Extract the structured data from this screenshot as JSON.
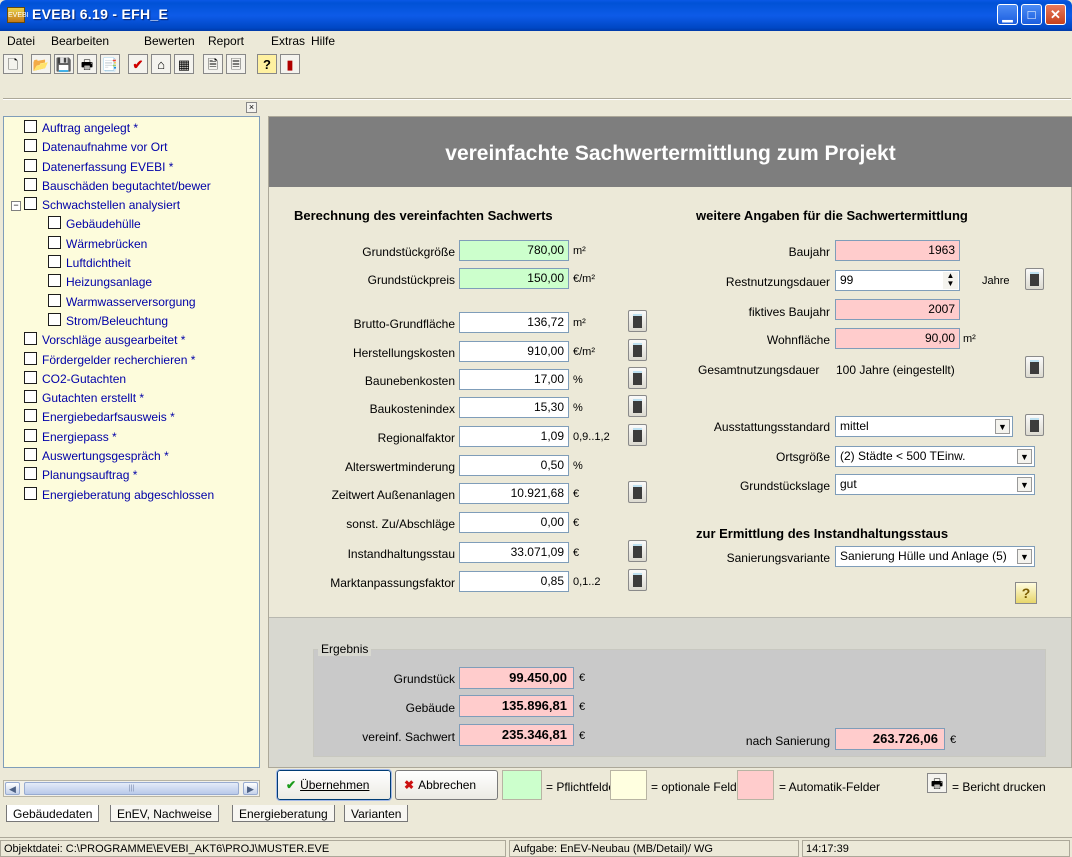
{
  "window": {
    "title": "EVEBI 6.19 - EFH_E",
    "icon_text": "EVEBI"
  },
  "menu": [
    "Datei",
    "Bearbeiten",
    "Bewerten",
    "Report",
    "Extras",
    "Hilfe"
  ],
  "tree": [
    {
      "label": "Auftrag angelegt *",
      "level": 0
    },
    {
      "label": "Datenaufnahme vor Ort",
      "level": 0
    },
    {
      "label": "Datenerfassung EVEBI *",
      "level": 0
    },
    {
      "label": "Bauschäden begutachtet/bewer",
      "level": 0
    },
    {
      "label": "Schwachstellen analysiert",
      "level": 0,
      "expander": "−"
    },
    {
      "label": "Gebäudehülle",
      "level": 1
    },
    {
      "label": "Wärmebrücken",
      "level": 1
    },
    {
      "label": "Luftdichtheit",
      "level": 1
    },
    {
      "label": "Heizungsanlage",
      "level": 1
    },
    {
      "label": "Warmwasserversorgung",
      "level": 1
    },
    {
      "label": "Strom/Beleuchtung",
      "level": 1
    },
    {
      "label": "Vorschläge ausgearbeitet *",
      "level": 0
    },
    {
      "label": "Fördergelder recherchieren *",
      "level": 0
    },
    {
      "label": "CO2-Gutachten",
      "level": 0
    },
    {
      "label": "Gutachten erstellt *",
      "level": 0
    },
    {
      "label": "Energiebedarfsausweis *",
      "level": 0
    },
    {
      "label": "Energiepass *",
      "level": 0
    },
    {
      "label": "Auswertungsgespräch *",
      "level": 0
    },
    {
      "label": "Planungsauftrag *",
      "level": 0
    },
    {
      "label": "Energieberatung abgeschlossen",
      "level": 0
    }
  ],
  "main": {
    "title": "vereinfachte Sachwertermittlung zum Projekt",
    "left_section": "Berechnung des vereinfachten Sachwerts",
    "right_section": "weitere Angaben für die Sachwertermittlung",
    "instand_section": "zur Ermittlung des Instandhaltungsstaus"
  },
  "left_rows": [
    {
      "label": "Grundstückgröße",
      "value": "780,00",
      "unit": "m²",
      "color": "green",
      "calc": false
    },
    {
      "label": "Grundstückpreis",
      "value": "150,00",
      "unit": "€/m²",
      "color": "green",
      "calc": false
    },
    {
      "label": "Brutto-Grundfläche",
      "value": "136,72",
      "unit": "m²",
      "color": "white",
      "calc": true
    },
    {
      "label": "Herstellungskosten",
      "value": "910,00",
      "unit": "€/m²",
      "color": "white",
      "calc": true
    },
    {
      "label": "Baunebenkosten",
      "value": "17,00",
      "unit": "%",
      "color": "white",
      "calc": true
    },
    {
      "label": "Baukostenindex",
      "value": "15,30",
      "unit": "%",
      "color": "white",
      "calc": true
    },
    {
      "label": "Regionalfaktor",
      "value": "1,09",
      "unit": "0,9..1,2",
      "color": "white",
      "calc": true
    },
    {
      "label": "Alterswertminderung",
      "value": "0,50",
      "unit": "%",
      "color": "white",
      "calc": false
    },
    {
      "label": "Zeitwert Außenanlagen",
      "value": "10.921,68",
      "unit": "€",
      "color": "white",
      "calc": true
    },
    {
      "label": "sonst. Zu/Abschläge",
      "value": "0,00",
      "unit": "€",
      "color": "white",
      "calc": false
    },
    {
      "label": "Instandhaltungsstau",
      "value": "33.071,09",
      "unit": "€",
      "color": "white",
      "calc": true
    },
    {
      "label": "Marktanpassungsfaktor",
      "value": "0,85",
      "unit": "0,1..2",
      "color": "white",
      "calc": true
    }
  ],
  "right": {
    "baujahr_label": "Baujahr",
    "baujahr": "1963",
    "restnutzung_label": "Restnutzungsdauer",
    "restnutzung": "99",
    "restnutzung_unit": "Jahre",
    "fiktiv_label": "fiktives Baujahr",
    "fiktiv": "2007",
    "wohnflaeche_label": "Wohnfläche",
    "wohnflaeche": "90,00",
    "wohnflaeche_unit": "m²",
    "gesamt_label": "Gesamtnutzungsdauer",
    "gesamt_value": "100 Jahre (eingestellt)",
    "ausstattung_label": "Ausstattungsstandard",
    "ausstattung": "mittel",
    "ortsgroesse_label": "Ortsgröße",
    "ortsgroesse": "(2) Städte < 500 TEinw.",
    "lage_label": "Grundstückslage",
    "lage": "gut",
    "sanierung_label": "Sanierungsvariante",
    "sanierung": "Sanierung Hülle und Anlage (5)"
  },
  "result": {
    "legend": "Ergebnis",
    "grundstueck_label": "Grundstück",
    "grundstueck": "99.450,00",
    "gebaeude_label": "Gebäude",
    "gebaeude": "135.896,81",
    "sachwert_label": "vereinf. Sachwert",
    "sachwert": "235.346,81",
    "nach_label": "nach Sanierung",
    "nach": "263.726,06",
    "currency": "€"
  },
  "buttons": {
    "ok": "Übernehmen",
    "cancel": "Abbrechen",
    "pflicht": "= Pflichtfelder",
    "optional": "= optionale Felder",
    "auto": "= Automatik-Felder",
    "print": "= Bericht drucken"
  },
  "tabs": [
    "Gebäudedaten",
    "EnEV, Nachweise",
    "Energieberatung",
    "Varianten"
  ],
  "status": {
    "file": "Objektdatei: C:\\PROGRAMME\\EVEBI_AKT6\\PROJ\\MUSTER.EVE",
    "task": "Aufgabe: EnEV-Neubau (MB/Detail)/ WG",
    "time": "14:17:39"
  },
  "colors": {
    "green": "#ccffcc",
    "pink": "#ffcccc",
    "yellow": "#ffffe0",
    "banner": "#7e7e7e"
  }
}
